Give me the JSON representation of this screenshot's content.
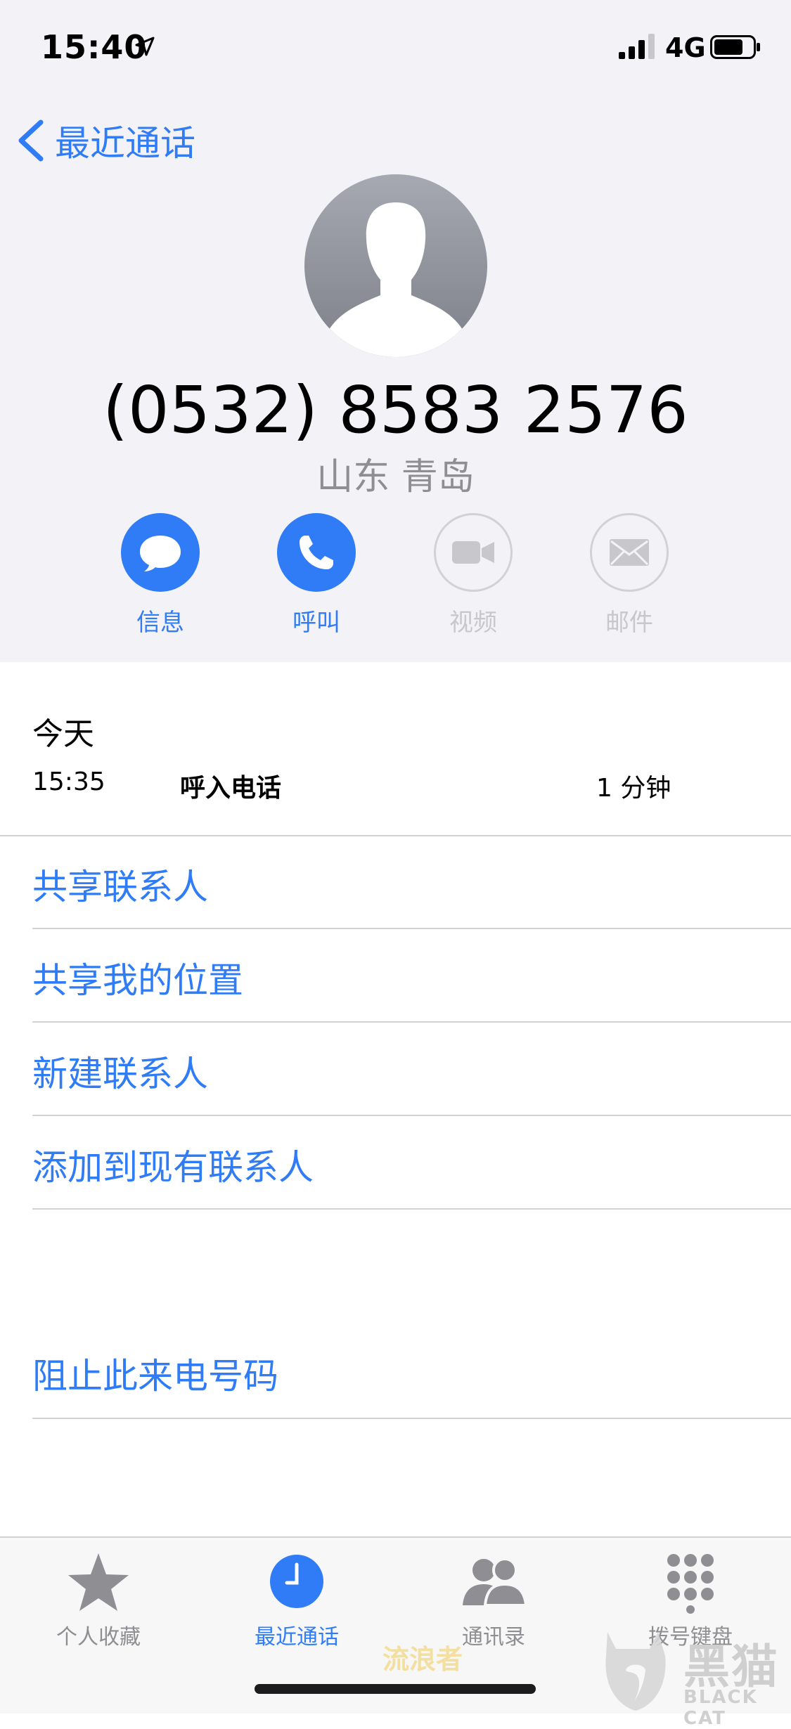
{
  "status_bar": {
    "time": "15:40",
    "network": "4G"
  },
  "nav": {
    "back_label": "最近通话"
  },
  "contact": {
    "number": "(0532) 8583 2576",
    "location": "山东 青岛"
  },
  "actions": [
    {
      "label": "信息",
      "icon": "message-icon",
      "enabled": true
    },
    {
      "label": "呼叫",
      "icon": "phone-icon",
      "enabled": true
    },
    {
      "label": "视频",
      "icon": "video-icon",
      "enabled": false
    },
    {
      "label": "邮件",
      "icon": "mail-icon",
      "enabled": false
    }
  ],
  "recents": {
    "day": "今天",
    "entries": [
      {
        "time": "15:35",
        "type": "呼入电话",
        "duration": "1 分钟"
      }
    ]
  },
  "options": [
    "共享联系人",
    "共享我的位置",
    "新建联系人",
    "添加到现有联系人"
  ],
  "block_option": "阻止此来电号码",
  "tabbar": {
    "tabs": [
      {
        "label": "个人收藏",
        "icon": "star-icon",
        "active": false
      },
      {
        "label": "最近通话",
        "icon": "clock-icon",
        "active": true
      },
      {
        "label": "通讯录",
        "icon": "contacts-icon",
        "active": false
      },
      {
        "label": "拨号键盘",
        "icon": "keypad-icon",
        "active": false
      }
    ]
  },
  "watermark": {
    "text": "流浪者",
    "brand": "黑猫",
    "brand_en": "BLACK CAT"
  },
  "colors": {
    "accent": "#2f7cf6",
    "header_bg": "#f2f2f7",
    "disabled": "#c7c7cc",
    "secondary_text": "#8e8e93"
  }
}
